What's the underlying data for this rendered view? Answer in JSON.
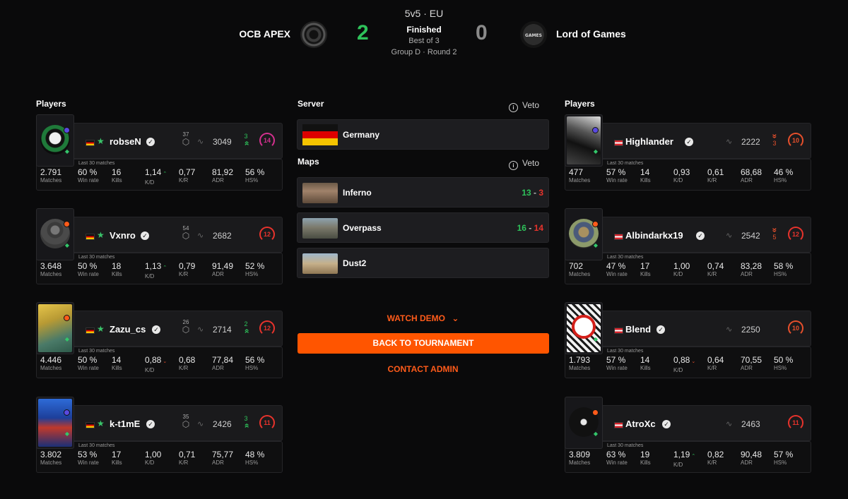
{
  "match": {
    "mode": "5v5 · EU",
    "status": "Finished",
    "best_of": "Best of 3",
    "round": "Group D · Round 2",
    "team_a": {
      "name": "OCB APEX",
      "score": "2"
    },
    "team_b": {
      "name": "Lord of Games",
      "score": "0",
      "logo_text": "GAMES"
    }
  },
  "colors": {
    "accent": "#ff5500",
    "win": "#2ec25a",
    "loss": "#e8332c",
    "background": "#0a0a0b"
  },
  "labels": {
    "players": "Players",
    "server": "Server",
    "maps": "Maps",
    "veto": "Veto",
    "last30": "Last 30 matches",
    "matches": "Matches",
    "win_rate": "Win rate",
    "kills": "Kills",
    "kd": "K/D",
    "kr": "K/R",
    "adr": "ADR",
    "hs": "HS%"
  },
  "server": {
    "country": "Germany"
  },
  "maps": [
    {
      "name": "Inferno",
      "score_a": "13",
      "score_b": "3"
    },
    {
      "name": "Overpass",
      "score_a": "16",
      "score_b": "14"
    },
    {
      "name": "Dust2"
    }
  ],
  "actions": {
    "watch_demo": "WATCH DEMO",
    "back_to_tournament": "BACK TO TOURNAMENT",
    "contact_admin": "CONTACT ADMIN"
  },
  "team_a_players": [
    {
      "name": "robseN",
      "country": "DE",
      "level_badge": "37",
      "elo": "3049",
      "delta": "3",
      "delta_dir": "up",
      "skill": "14",
      "matches": "2.791",
      "win_rate": "60 %",
      "kills": "16",
      "kd": "1,14",
      "kd_trend": "up",
      "kr": "0,77",
      "adr": "81,92",
      "hs": "56 %"
    },
    {
      "name": "Vxnro",
      "country": "DE",
      "level_badge": "54",
      "elo": "2682",
      "skill": "12",
      "matches": "3.648",
      "win_rate": "50 %",
      "kills": "18",
      "kd": "1,13",
      "kd_trend": "up",
      "kr": "0,79",
      "adr": "91,49",
      "hs": "52 %"
    },
    {
      "name": "Zazu_cs",
      "country": "DE",
      "level_badge": "26",
      "elo": "2714",
      "delta": "2",
      "delta_dir": "up",
      "skill": "12",
      "matches": "4.446",
      "win_rate": "50 %",
      "kills": "14",
      "kd": "0,88",
      "kd_trend": "down",
      "kr": "0,68",
      "adr": "77,84",
      "hs": "56 %"
    },
    {
      "name": "k-t1mE",
      "country": "DE",
      "level_badge": "35",
      "elo": "2426",
      "delta": "3",
      "delta_dir": "up",
      "skill": "11",
      "matches": "3.802",
      "win_rate": "53 %",
      "kills": "17",
      "kd": "1,00",
      "kr": "0,71",
      "adr": "75,77",
      "hs": "48 %"
    }
  ],
  "team_b_players": [
    {
      "name": "Highlander",
      "country": "AT",
      "elo": "2222",
      "delta": "3",
      "delta_dir": "down",
      "skill": "10",
      "matches": "477",
      "win_rate": "57 %",
      "kills": "14",
      "kd": "0,93",
      "kr": "0,61",
      "adr": "68,68",
      "hs": "46 %"
    },
    {
      "name": "Albindarkx19",
      "country": "AT",
      "elo": "2542",
      "delta": "5",
      "delta_dir": "down",
      "skill": "12",
      "matches": "702",
      "win_rate": "47 %",
      "kills": "17",
      "kd": "1,00",
      "kr": "0,74",
      "adr": "83,28",
      "hs": "58 %"
    },
    {
      "name": "Blend",
      "country": "AT",
      "elo": "2250",
      "skill": "10",
      "matches": "1.793",
      "win_rate": "57 %",
      "kills": "14",
      "kd": "0,88",
      "kd_trend": "down",
      "kr": "0,64",
      "adr": "70,55",
      "hs": "50 %"
    },
    {
      "name": "AtroXc",
      "country": "AT",
      "elo": "2463",
      "skill": "11",
      "matches": "3.809",
      "win_rate": "63 %",
      "kills": "19",
      "kd": "1,19",
      "kd_trend": "up",
      "kr": "0,82",
      "adr": "90,48",
      "hs": "57 %"
    }
  ]
}
